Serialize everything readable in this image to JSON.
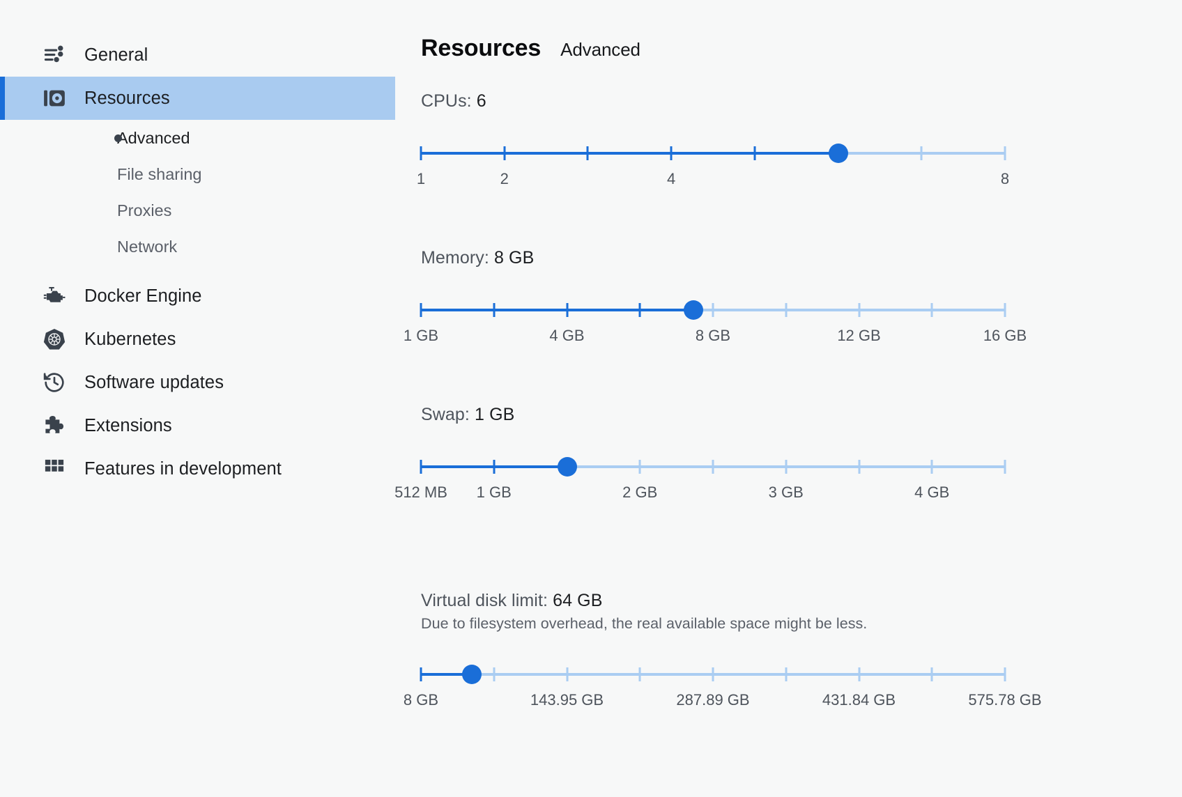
{
  "sidebar": {
    "items": [
      {
        "id": "general",
        "label": "General",
        "icon": "sliders-icon",
        "active": false
      },
      {
        "id": "resources",
        "label": "Resources",
        "icon": "resources-icon",
        "active": true
      },
      {
        "id": "docker-engine",
        "label": "Docker Engine",
        "icon": "engine-icon",
        "active": false
      },
      {
        "id": "kubernetes",
        "label": "Kubernetes",
        "icon": "kubernetes-helm-icon",
        "active": false
      },
      {
        "id": "software-updates",
        "label": "Software updates",
        "icon": "clock-history-icon",
        "active": false
      },
      {
        "id": "extensions",
        "label": "Extensions",
        "icon": "puzzle-piece-icon",
        "active": false
      },
      {
        "id": "features-in-development",
        "label": "Features in development",
        "icon": "grid-icon",
        "active": false
      }
    ],
    "sub_items": [
      {
        "id": "advanced",
        "label": "Advanced",
        "current": true
      },
      {
        "id": "file-sharing",
        "label": "File sharing",
        "current": false
      },
      {
        "id": "proxies",
        "label": "Proxies",
        "current": false
      },
      {
        "id": "network",
        "label": "Network",
        "current": false
      }
    ]
  },
  "header": {
    "title": "Resources",
    "subtitle": "Advanced"
  },
  "colors": {
    "accent": "#1a6ed8",
    "track_inactive": "#aacdf2",
    "highlight_row": "#a9cbf0",
    "page_bg": "#f7f8f8",
    "text_primary": "#1c1e21",
    "text_muted": "#5b6069"
  },
  "sliders": [
    {
      "id": "cpus",
      "label_prefix": "CPUs: ",
      "value_text": "6",
      "description": "",
      "min": 1,
      "max": 8,
      "value": 6,
      "ticks": [
        1,
        2,
        3,
        4,
        5,
        6,
        7,
        8
      ],
      "tick_labels": [
        {
          "value": 1,
          "text": "1"
        },
        {
          "value": 2,
          "text": "2"
        },
        {
          "value": 4,
          "text": "4"
        },
        {
          "value": 8,
          "text": "8"
        }
      ]
    },
    {
      "id": "memory",
      "label_prefix": "Memory: ",
      "value_text": "8 GB",
      "description": "",
      "min": 1,
      "max": 16,
      "value": 8,
      "ticks": [
        1,
        2.875,
        4.75,
        6.625,
        8.5,
        10.375,
        12.25,
        14.125,
        16
      ],
      "tick_labels": [
        {
          "value": 1,
          "text": "1 GB"
        },
        {
          "value": 4.75,
          "text": "4 GB"
        },
        {
          "value": 8.5,
          "text": "8 GB"
        },
        {
          "value": 12.25,
          "text": "12 GB"
        },
        {
          "value": 16,
          "text": "16 GB"
        }
      ]
    },
    {
      "id": "swap",
      "label_prefix": "Swap: ",
      "value_text": "1 GB",
      "description": "",
      "min": 0,
      "max": 4096,
      "value": 1024,
      "ticks": [
        0,
        512,
        1024,
        1536,
        2048,
        2560,
        3072,
        3584,
        4096
      ],
      "tick_labels": [
        {
          "value": 0,
          "text": "512 MB"
        },
        {
          "value": 512,
          "text": "1 GB"
        },
        {
          "value": 1536,
          "text": "2 GB"
        },
        {
          "value": 2560,
          "text": "3 GB"
        },
        {
          "value": 3584,
          "text": "4 GB"
        }
      ]
    },
    {
      "id": "virtual-disk-limit",
      "label_prefix": "Virtual disk limit: ",
      "value_text": "64 GB",
      "description": "Due to filesystem overhead, the real available space might be less.",
      "min": 8,
      "max": 647.75,
      "value": 64,
      "ticks": [
        8,
        87.97,
        167.94,
        247.91,
        327.88,
        407.85,
        487.82,
        567.79,
        647.75
      ],
      "tick_labels": [
        {
          "value": 8,
          "text": "8 GB"
        },
        {
          "value": 167.94,
          "text": "143.95 GB"
        },
        {
          "value": 327.88,
          "text": "287.89 GB"
        },
        {
          "value": 487.82,
          "text": "431.84 GB"
        },
        {
          "value": 647.75,
          "text": "575.78 GB"
        }
      ]
    }
  ]
}
